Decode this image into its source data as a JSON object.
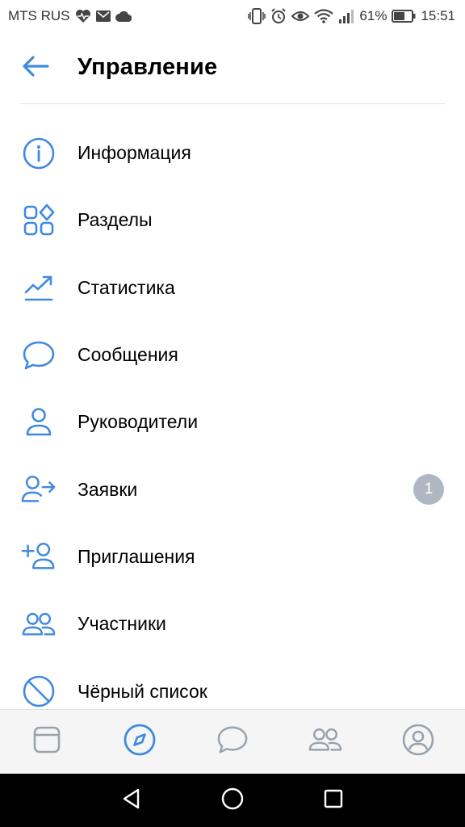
{
  "status_bar": {
    "carrier": "MTS RUS",
    "battery_percent": "61%",
    "time": "15:51"
  },
  "header": {
    "title": "Управление"
  },
  "menu": {
    "items": [
      {
        "label": "Информация",
        "icon": "info-icon"
      },
      {
        "label": "Разделы",
        "icon": "sections-icon"
      },
      {
        "label": "Статистика",
        "icon": "statistics-icon"
      },
      {
        "label": "Сообщения",
        "icon": "message-icon"
      },
      {
        "label": "Руководители",
        "icon": "user-icon"
      },
      {
        "label": "Заявки",
        "icon": "user-arrow-icon",
        "badge": "1"
      },
      {
        "label": "Приглашения",
        "icon": "user-add-icon"
      },
      {
        "label": "Участники",
        "icon": "users-icon"
      },
      {
        "label": "Чёрный список",
        "icon": "block-icon"
      }
    ]
  },
  "tabbar": {
    "tabs": [
      "newsfeed-tab",
      "explore-tab",
      "messages-tab",
      "friends-tab",
      "profile-tab"
    ],
    "active": "explore-tab"
  },
  "colors": {
    "accent": "#3f8ae0",
    "tab_inactive": "#99a2ad",
    "badge": "#aeb7c2"
  }
}
